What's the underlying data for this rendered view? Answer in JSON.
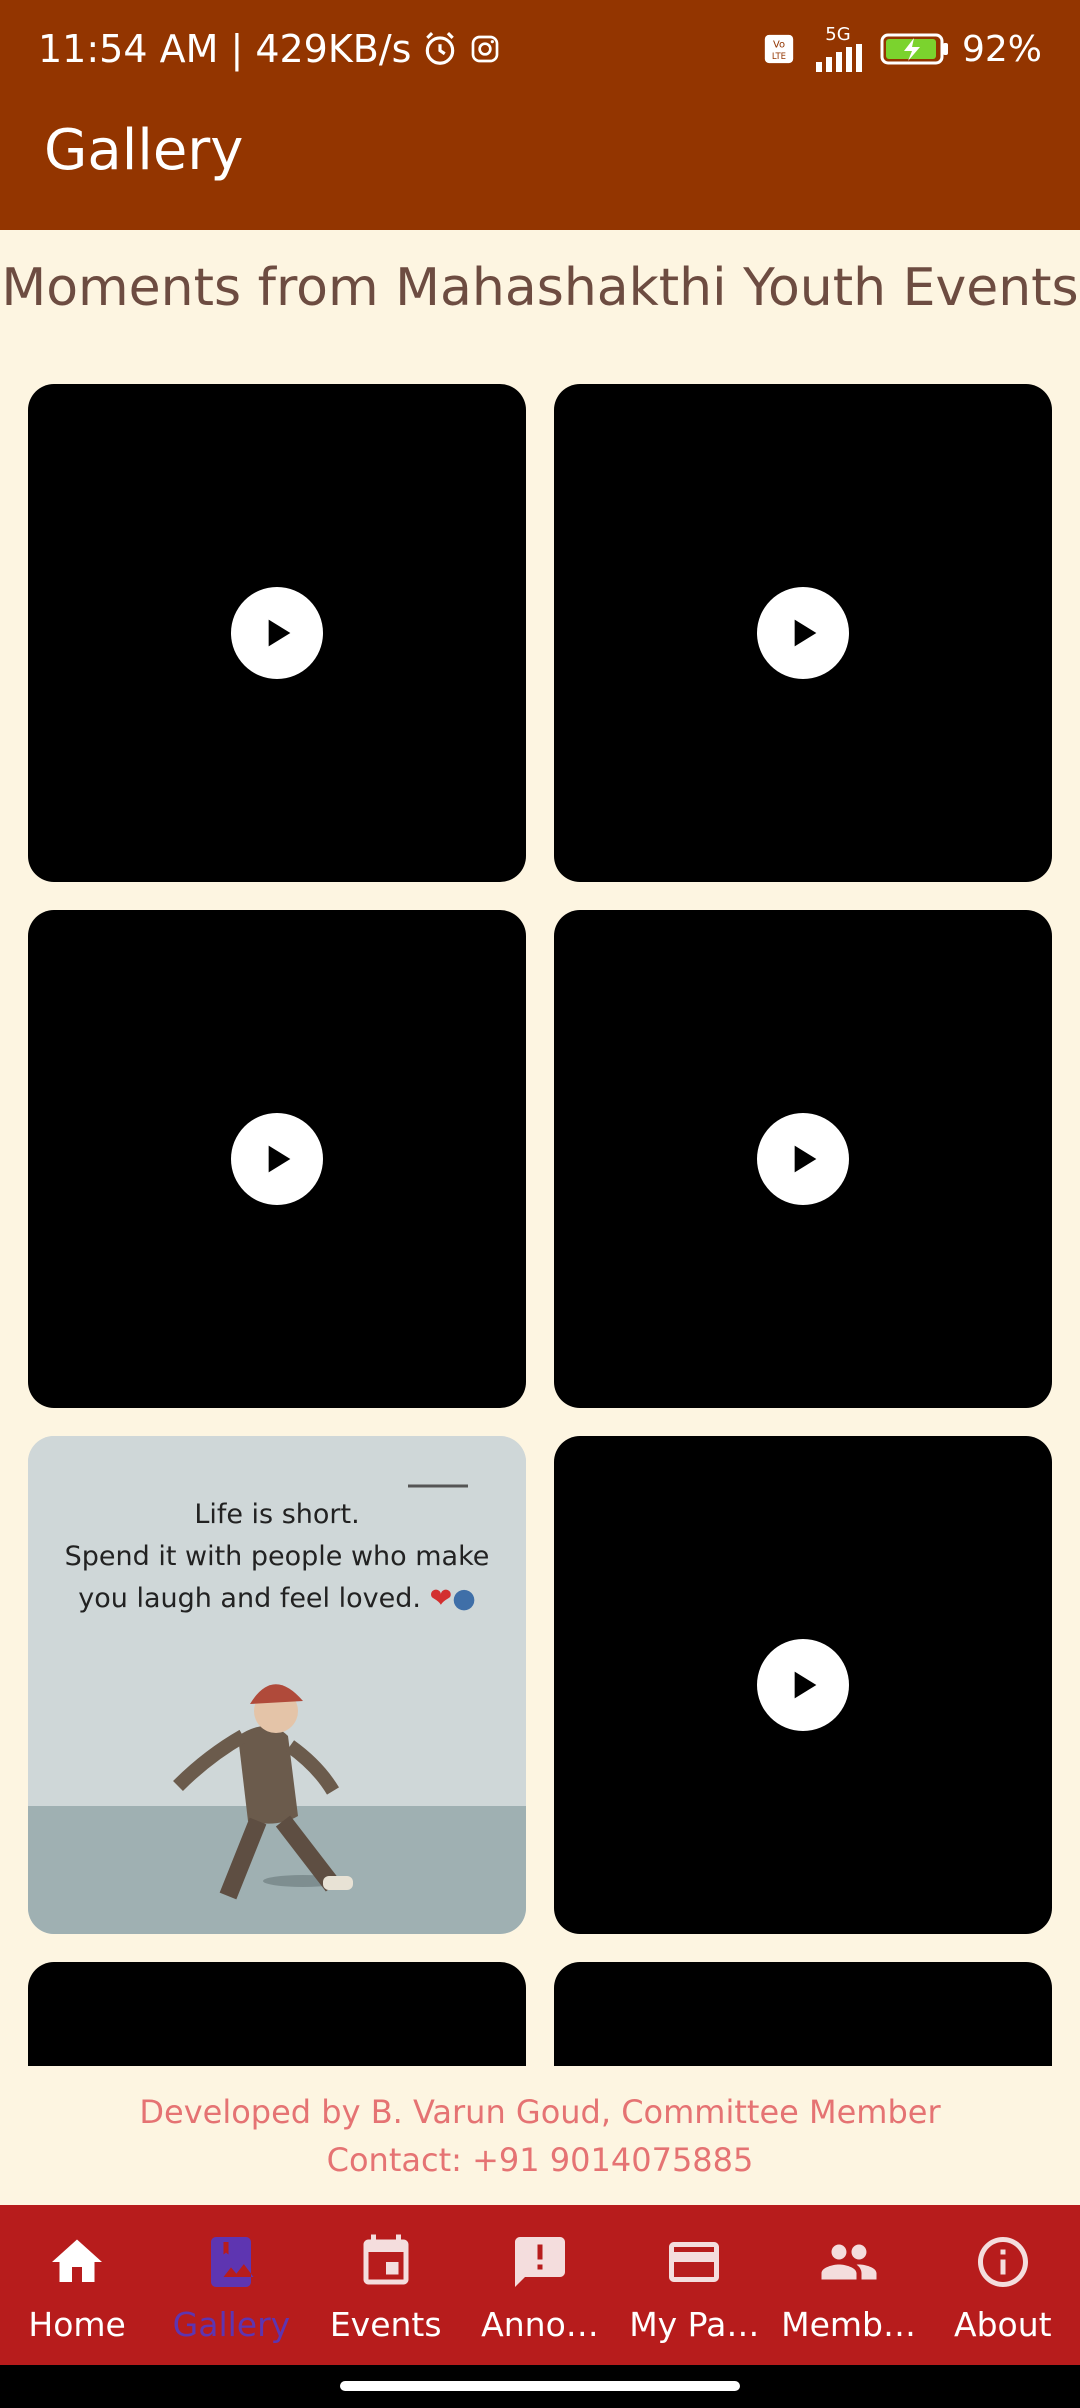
{
  "status_bar": {
    "time_speed": "11:54 AM | 429KB/s",
    "network": "5G",
    "volte": "Vo LTE",
    "battery": "92%"
  },
  "app_bar": {
    "title": "Gallery"
  },
  "page": {
    "subtitle": "Moments from Mahashakthi Youth Events"
  },
  "gallery": {
    "items": [
      {
        "type": "video"
      },
      {
        "type": "video"
      },
      {
        "type": "video"
      },
      {
        "type": "video"
      },
      {
        "type": "image",
        "caption_lines": [
          "Life is short.",
          "Spend it with people who make",
          "you laugh and feel loved."
        ]
      },
      {
        "type": "video"
      },
      {
        "type": "video"
      },
      {
        "type": "video"
      }
    ]
  },
  "footer": {
    "developer": "Developed by B. Varun Goud, Committee Member",
    "contact": "Contact: +91 9014075885"
  },
  "bottom_nav": {
    "active": "Gallery",
    "items": [
      {
        "label": "Home",
        "icon": "home-icon"
      },
      {
        "label": "Gallery",
        "icon": "photo-album-icon"
      },
      {
        "label": "Events",
        "icon": "calendar-icon"
      },
      {
        "label": "Anno…",
        "icon": "announcement-icon"
      },
      {
        "label": "My Pa…",
        "icon": "payment-card-icon"
      },
      {
        "label": "Memb…",
        "icon": "people-icon"
      },
      {
        "label": "About",
        "icon": "info-icon"
      }
    ]
  },
  "colors": {
    "app_bar": "#933500",
    "background": "#FDF5E1",
    "bottom_nav": "#B71C1C",
    "active_nav": "#5E35B1",
    "footer_text": "#E57373"
  }
}
